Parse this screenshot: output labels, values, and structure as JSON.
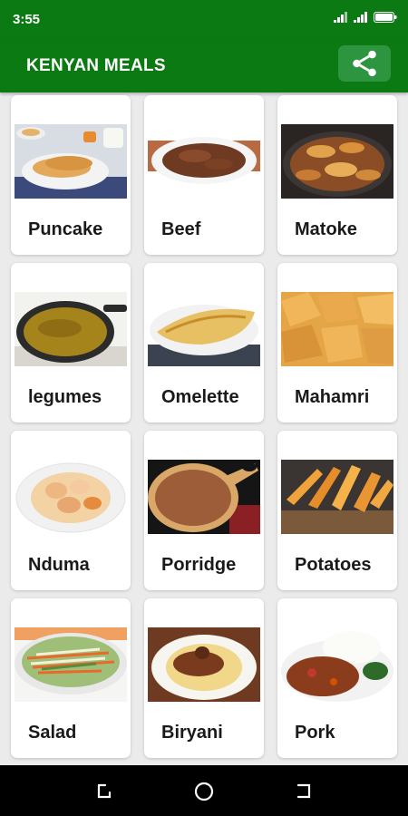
{
  "status_bar": {
    "time": "3:55"
  },
  "app_bar": {
    "title": "KENYAN MEALS",
    "share_icon": "share-icon"
  },
  "meals": [
    {
      "label": "Puncake",
      "image": "pancake-photo"
    },
    {
      "label": "Beef",
      "image": "beef-photo"
    },
    {
      "label": "Matoke",
      "image": "matoke-photo"
    },
    {
      "label": "legumes",
      "image": "legumes-photo"
    },
    {
      "label": "Omelette",
      "image": "omelette-photo"
    },
    {
      "label": "Mahamri",
      "image": "mahamri-photo"
    },
    {
      "label": "Nduma",
      "image": "nduma-photo"
    },
    {
      "label": "Porridge",
      "image": "porridge-photo"
    },
    {
      "label": "Potatoes",
      "image": "potatoes-photo"
    },
    {
      "label": "Salad",
      "image": "salad-photo"
    },
    {
      "label": "Biryani",
      "image": "biryani-photo"
    },
    {
      "label": "Pork",
      "image": "pork-photo"
    }
  ],
  "nav_bar": {
    "icons": [
      "recents-icon",
      "home-icon",
      "back-icon"
    ]
  },
  "colors": {
    "primary": "#0b7a12",
    "share_button": "#2d9440",
    "background": "#ebebeb"
  }
}
